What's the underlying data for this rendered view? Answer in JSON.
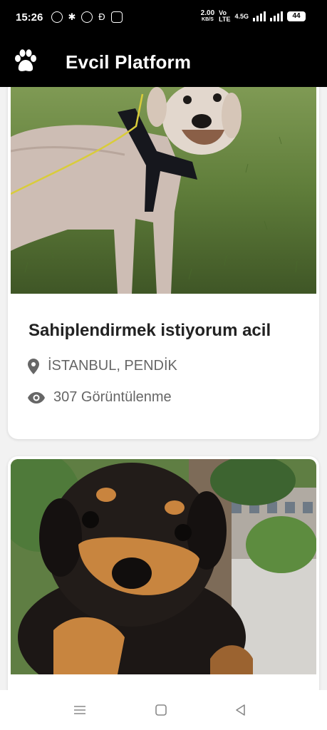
{
  "status_bar": {
    "time": "15:26",
    "speed_value": "2.00",
    "speed_unit": "KB/S",
    "network_top": "Vo",
    "network_bottom": "LTE",
    "signal_label": "4.5G",
    "battery": "44"
  },
  "app_bar": {
    "title": "Evcil Platform",
    "logo_icon": "paw-icon"
  },
  "listings": [
    {
      "title": "Sahiplendirmek istiyorum acil",
      "location": "İSTANBUL, PENDİK",
      "views": "307 Görüntülenme"
    }
  ],
  "navigation": {
    "icons": [
      "menu-icon",
      "home-icon",
      "back-icon"
    ]
  },
  "colors": {
    "app_bar": "#000000",
    "background": "#f2f2f2",
    "card": "#ffffff",
    "title_text": "#222222",
    "meta_text": "#666666"
  }
}
